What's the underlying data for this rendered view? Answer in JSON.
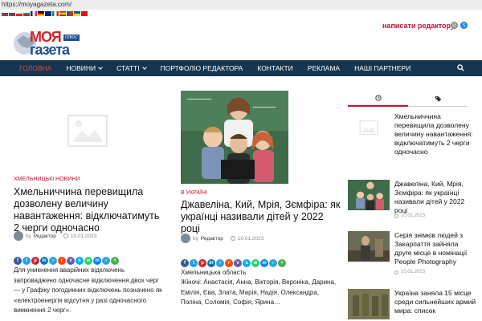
{
  "browser": {
    "url": "https://moyagazeta.com/"
  },
  "header": {
    "logo_line1": "МОЯ",
    "logo_line2": "газета",
    "logo_badge": "ПЛЮС",
    "write_link": "написати редактору"
  },
  "nav": {
    "items": [
      {
        "label": "ГОЛОВНА",
        "active": true,
        "has_dropdown": false
      },
      {
        "label": "НОВИНИ",
        "active": false,
        "has_dropdown": true
      },
      {
        "label": "СТАТТІ",
        "active": false,
        "has_dropdown": true
      },
      {
        "label": "ПОРТФОЛІО РЕДАКТОРА",
        "active": false,
        "has_dropdown": false
      },
      {
        "label": "КОНТАКТИ",
        "active": false,
        "has_dropdown": false
      },
      {
        "label": "РЕКЛАМА",
        "active": false,
        "has_dropdown": false
      },
      {
        "label": "НАШІ ПАРТНЕРИ",
        "active": false,
        "has_dropdown": false
      }
    ]
  },
  "articles": [
    {
      "category": "ХМЕЛЬНИЦЬКІ НОВИНИ",
      "title": "Хмельниччина перевищила дозволену величину навантаження: відключатимуть 2 черги одночасно",
      "author_prefix": "by",
      "author": "Редактор",
      "date": "10.01.2023",
      "excerpt": "Для уникнення аварійних відключень запроваджено одночасне відключення двох черг — у Графіку погодинних відключень позначено як «електроенергія відсутня у разі одночасного вимкнення 2 черг»."
    },
    {
      "category": "В УКРАЇНІ",
      "title": "Джавеліна, Кий, Мрія, Зємфіра: як українці називали дітей у 2022 році",
      "author_prefix": "by",
      "author": "Редактор",
      "date": "10.01.2023",
      "excerpt_line1": "Хмельницька область",
      "excerpt": "Жіночі: Анастасія, Анна, Вікторія, Вероніка, Дарина, Емілія, Єва, Злата, Марія, Надія, Олександра, Поліна, Соломія, Софія, Ярина…"
    }
  ],
  "sidebar": {
    "tabs": [
      {
        "icon": "clock-icon"
      },
      {
        "icon": "tag-icon"
      }
    ],
    "items": [
      {
        "title": "Хмельниччина перевищила дозволену величину навантаження: відключатимуть 2 черги одночасно",
        "date": "10.01.2023"
      },
      {
        "title": "Джавеліна, Кий, Мрія, Зємфіра: як українці називали дітей у 2022 році",
        "date": "10.01.2023"
      },
      {
        "title": "Серія знімків людей з Закарпаття зайняла друге місце в номінації People Photography",
        "date": "10.01.2023"
      },
      {
        "title": "Україна заняла 15 місце среди сильнейших армий мира: список",
        "date": ""
      }
    ]
  },
  "colors": {
    "accent": "#c8102e",
    "nav_bg": "#16364f",
    "logo_red": "#d8232a",
    "logo_blue": "#1e4f8c"
  }
}
